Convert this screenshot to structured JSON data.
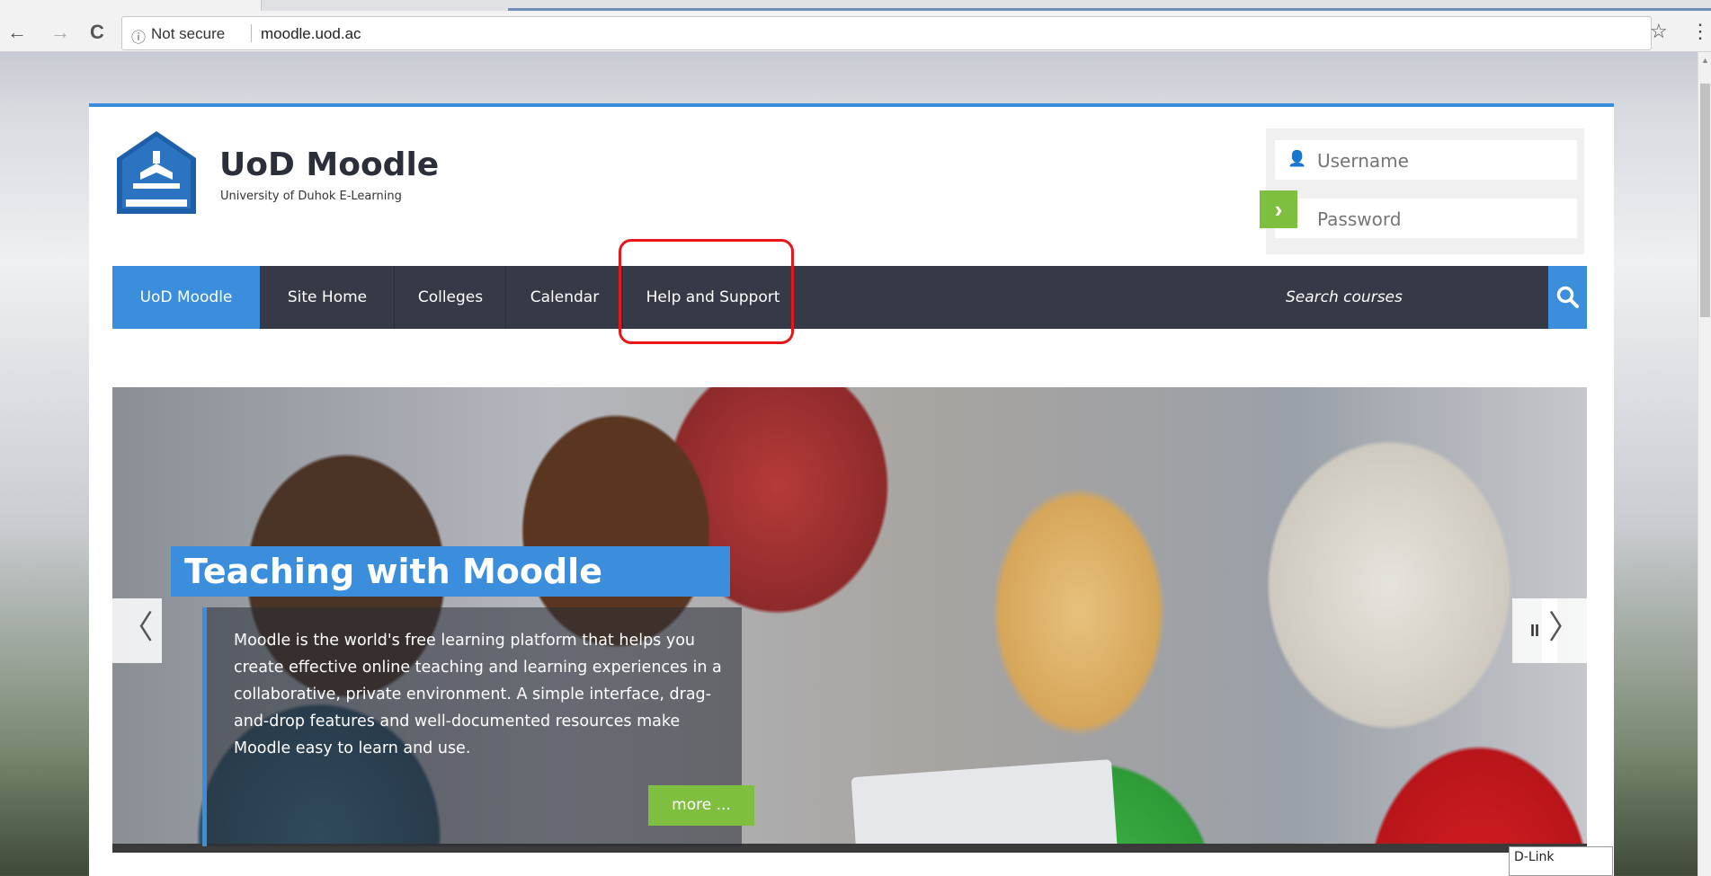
{
  "browser": {
    "back_icon": "←",
    "forward_icon": "→",
    "reload_icon": "C",
    "info_icon": "ⓘ",
    "security_label": "Not secure",
    "url": "moodle.uod.ac",
    "bookmark_icon": "☆",
    "menu_icon": "⋮"
  },
  "header": {
    "site_title": "UoD Moodle",
    "site_subtitle": "University of Duhok E-Learning"
  },
  "login": {
    "username_placeholder": "Username",
    "password_placeholder": "Password",
    "submit_icon": "›"
  },
  "nav": {
    "items": [
      {
        "label": "UoD Moodle"
      },
      {
        "label": "Site Home"
      },
      {
        "label": "Colleges"
      },
      {
        "label": "Calendar"
      },
      {
        "label": "Help and Support"
      }
    ],
    "search_label": "Search courses"
  },
  "slider": {
    "caption_title": "Teaching with Moodle",
    "caption_text": "Moodle is the world's free learning platform that helps you create effective online teaching and learning experiences in a collaborative, private environment. A simple interface, drag-and-drop features and well-documented resources make Moodle easy to learn and use.",
    "more_label": "more ...",
    "prev_icon": "〈",
    "pause_icon": "II",
    "next_icon": "〉"
  },
  "tooltip": {
    "text": "D-Link"
  },
  "colors": {
    "accent": "#3b8edb",
    "navbar": "#353a46",
    "green": "#7fbf3f",
    "highlight": "#e8151b"
  }
}
